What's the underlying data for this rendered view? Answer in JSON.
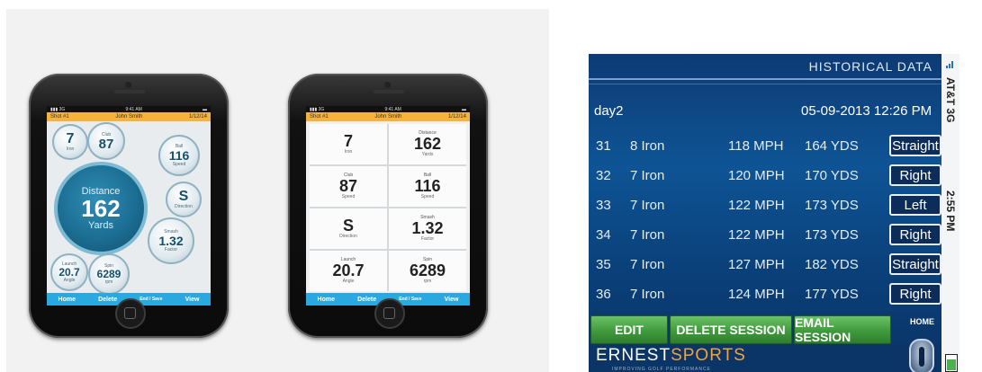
{
  "phones": {
    "common": {
      "shot": "Shot #1",
      "player": "John Smith",
      "date": "1/12/14",
      "tabs": [
        "Home",
        "Delete",
        "End / Save",
        "View"
      ]
    },
    "bubbles": {
      "club": {
        "value": "7",
        "label": "Iron"
      },
      "club_speed": {
        "value": "87",
        "label": "Club",
        "unit": "mph"
      },
      "ball_speed": {
        "value": "116",
        "label": "Ball",
        "sub": "Speed",
        "unit": "mph"
      },
      "distance": {
        "label": "Distance",
        "value": "162",
        "unit": "Yards"
      },
      "direction": {
        "value": "S",
        "label": "Direction"
      },
      "smash": {
        "label": "Smash",
        "value": "1.32",
        "sub": "Factor"
      },
      "launch": {
        "label": "Launch",
        "value": "20.7",
        "sub": "Angle"
      },
      "spin": {
        "label": "Spin",
        "value": "6289",
        "unit": "rpm"
      }
    },
    "grid": [
      {
        "label": "",
        "value": "7",
        "unit": "Iron"
      },
      {
        "label": "Distance",
        "value": "162",
        "unit": "Yards"
      },
      {
        "label": "Club",
        "value": "87",
        "unit": "Speed"
      },
      {
        "label": "Ball",
        "value": "116",
        "unit": "Speed"
      },
      {
        "label": "",
        "value": "S",
        "unit": "Direction"
      },
      {
        "label": "Smash",
        "value": "1.32",
        "unit": "Factor"
      },
      {
        "label": "Launch",
        "value": "20.7",
        "unit": "Angle"
      },
      {
        "label": "Spin",
        "value": "6289",
        "unit": "rpm"
      }
    ]
  },
  "historical": {
    "title": "HISTORICAL DATA",
    "session_name": "day2",
    "session_datetime": "05-09-2013 12:26 PM",
    "rows": [
      {
        "num": "31",
        "club": "8 Iron",
        "speed": "118 MPH",
        "distance": "164 YDS",
        "direction": "Straight"
      },
      {
        "num": "32",
        "club": "7 Iron",
        "speed": "120 MPH",
        "distance": "170 YDS",
        "direction": "Right"
      },
      {
        "num": "33",
        "club": "7 Iron",
        "speed": "122 MPH",
        "distance": "173 YDS",
        "direction": "Left"
      },
      {
        "num": "34",
        "club": "7 Iron",
        "speed": "122 MPH",
        "distance": "173 YDS",
        "direction": "Right"
      },
      {
        "num": "35",
        "club": "7 Iron",
        "speed": "127 MPH",
        "distance": "182 YDS",
        "direction": "Straight"
      },
      {
        "num": "36",
        "club": "7 Iron",
        "speed": "124 MPH",
        "distance": "177 YDS",
        "direction": "Right"
      }
    ],
    "buttons": {
      "edit": "EDIT",
      "delete": "DELETE SESSION",
      "email": "EMAIL SESSION",
      "home": "HOME"
    },
    "logo_ernest": "ERNEST",
    "logo_sports": "SPORTS",
    "tagline": "IMPROVING GOLF PERFORMANCE",
    "status": {
      "carrier": "AT&T 3G",
      "time": "2:55 PM"
    }
  }
}
